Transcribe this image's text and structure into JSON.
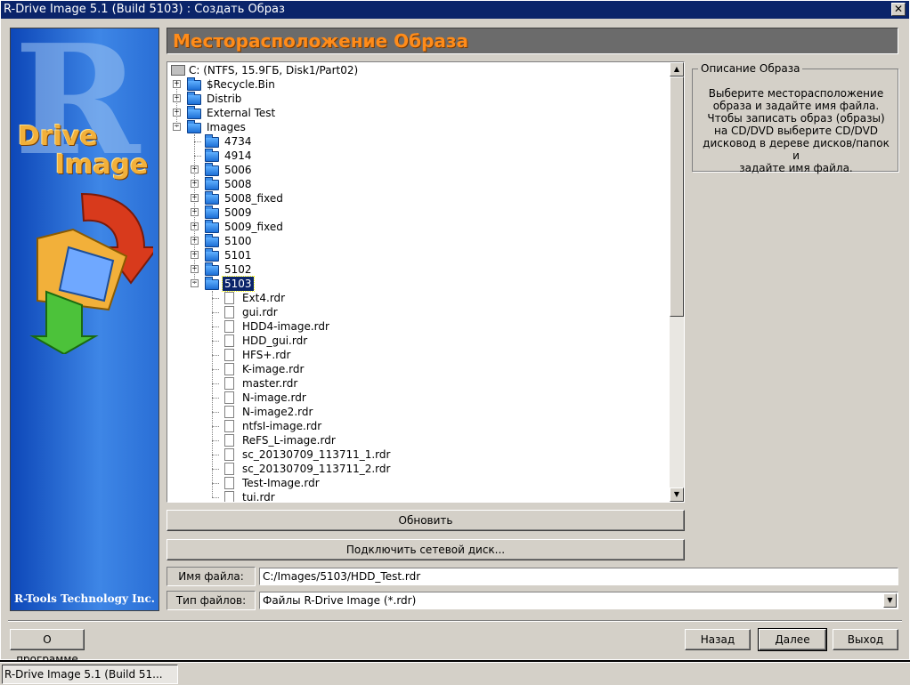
{
  "window": {
    "title": "R-Drive Image 5.1 (Build 5103) : Создать Образ",
    "close_glyph": "✕"
  },
  "sidebar": {
    "logo_letter": "R",
    "logo_word1": "Drive",
    "logo_word2": "Image",
    "brand": "R-Tools Technology Inc."
  },
  "header": {
    "title": "Месторасположение Образа"
  },
  "tree": {
    "drive": "C: (NTFS, 15.9ГБ, Disk1/Part02)",
    "root_folders": [
      "$Recycle.Bin",
      "Distrib",
      "External Test",
      "Images"
    ],
    "images_children": [
      "4734",
      "4914",
      "5006",
      "5008",
      "5008_fixed",
      "5009",
      "5009_fixed",
      "5100",
      "5101",
      "5102",
      "5103"
    ],
    "selected": "5103",
    "files": [
      "Ext4.rdr",
      "gui.rdr",
      "HDD4-image.rdr",
      "HDD_gui.rdr",
      "HFS+.rdr",
      "K-image.rdr",
      "master.rdr",
      "N-image.rdr",
      "N-image2.rdr",
      "ntfsI-image.rdr",
      "ReFS_L-image.rdr",
      "sc_20130709_113711_1.rdr",
      "sc_20130709_113711_2.rdr",
      "Test-Image.rdr",
      "tui.rdr"
    ]
  },
  "buttons": {
    "refresh": "Обновить",
    "map_network": "Подключить сетевой диск...",
    "about": "О программе",
    "back": "Назад",
    "next": "Далее",
    "exit": "Выход"
  },
  "description": {
    "legend": "Описание Образа",
    "text": "Выберите месторасположение\nобраза и задайте имя файла.\nЧтобы записать образ (образы)\nна CD/DVD выберите CD/DVD\nдисковод в дереве дисков/папок и\nзадайте имя файла."
  },
  "fields": {
    "filename_label": "Имя файла:",
    "filename_value": "C:/Images/5103/HDD_Test.rdr",
    "filetype_label": "Тип файлов:",
    "filetype_value": "Файлы R-Drive Image (*.rdr)"
  },
  "taskbar": {
    "item": "R-Drive Image 5.1 (Build 51..."
  }
}
